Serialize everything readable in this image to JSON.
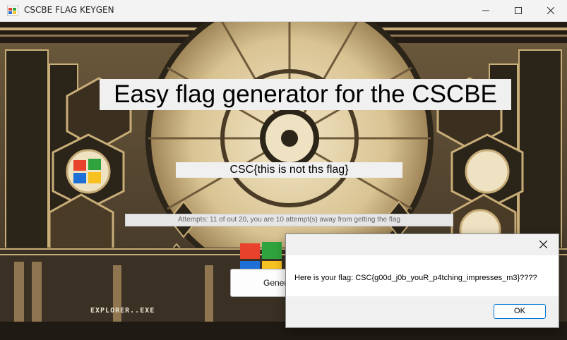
{
  "window": {
    "title": "CSCBE FLAG KEYGEN",
    "icon": "windows-app-icon",
    "controls": [
      "minimize-icon",
      "maximize-icon",
      "close-icon"
    ]
  },
  "main": {
    "heading": "Easy flag generator for the CSCBE",
    "flag_text": "CSC{this is not ths flag}",
    "attempts_text": "Attempts: 11 of out 20, you are 10 attempt(s) away from getting the flag",
    "generate_button_label": "Gener",
    "background_caption": "EXPLORER..EXE"
  },
  "dialog": {
    "message": "Here is your flag: CSC{g00d_j0b_youR_p4tching_impresses_m3}????",
    "ok_label": "OK"
  },
  "colors": {
    "art_dark": "#2b2418",
    "art_gold": "#c9ad78",
    "art_cream": "#efe2c2",
    "dialog_accent": "#0078d4"
  }
}
